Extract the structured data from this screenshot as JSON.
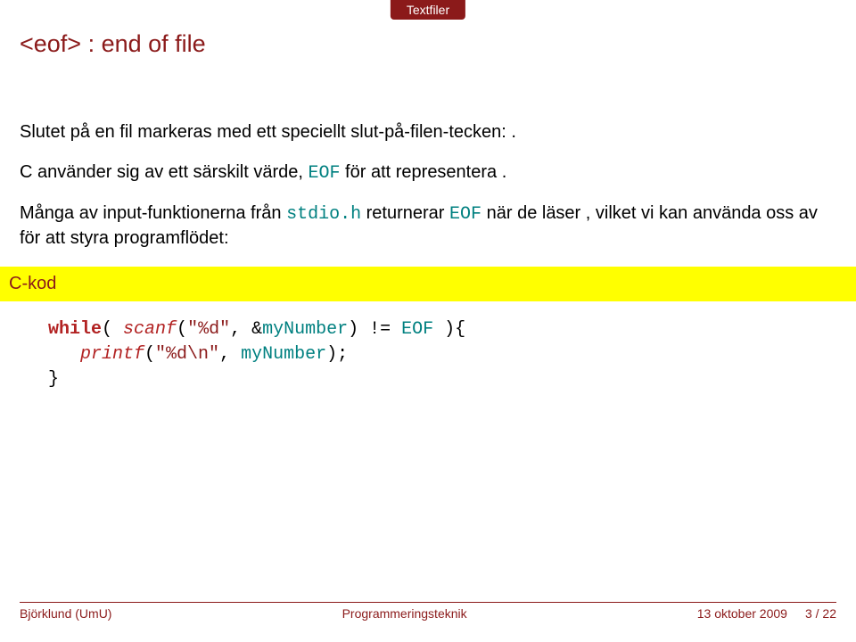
{
  "topTab": "Textfiler",
  "title": "<eof> : end of file",
  "para1_a": "Slutet på en fil markeras med ett speciellt slut-på-filen-tecken: ",
  "para1_b": ".",
  "para2_a": "C använder sig av ett särskilt värde, ",
  "para2_eof": "EOF",
  "para2_b": " för att representera ",
  "para2_c": ".",
  "para3_a": "Många av input-funktionerna från ",
  "para3_stdio": "stdio.h",
  "para3_b": " returnerar ",
  "para3_eof": "EOF",
  "para3_c": " när de läser ",
  "para3_d": ", vilket vi kan använda oss av för att styra programflödet:",
  "codeTitle": "C-kod",
  "code": {
    "while": "while",
    "open1": "( ",
    "scanf": "scanf",
    "args1": "(",
    "str1": "\"%d\"",
    "comma": ", ",
    "amp": "&",
    "myNumber": "myNumber",
    "close1": ") ",
    "neq": "!= ",
    "eof": "EOF",
    "close2": " ){",
    "printf": "printf",
    "args2": "(",
    "str2": "\"%d\\n\"",
    "comma2": ", ",
    "myNumber2": "myNumber",
    "close3": ");",
    "closeBrace": "}"
  },
  "footer": {
    "left": "Björklund (UmU)",
    "center": "Programmeringsteknik",
    "date": "13 oktober 2009",
    "page": "3 / 22"
  }
}
